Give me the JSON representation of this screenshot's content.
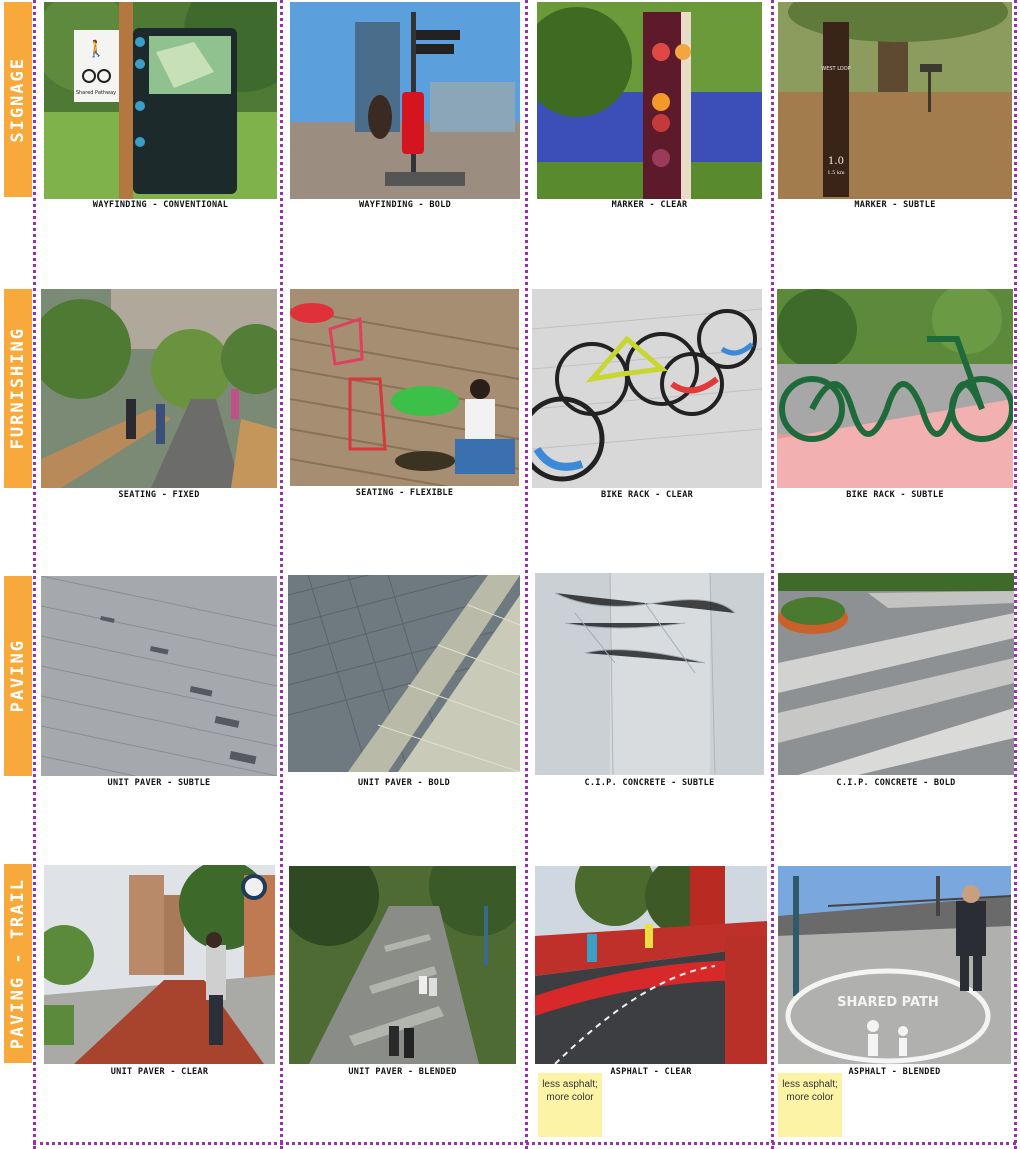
{
  "rows": [
    {
      "label": "SIGNAGE",
      "captions": [
        "WAYFINDING - CONVENTIONAL",
        "WAYFINDING - BOLD",
        "MARKER - CLEAR",
        "MARKER - SUBTLE"
      ]
    },
    {
      "label": "FURNISHING",
      "captions": [
        "SEATING - FIXED",
        "SEATING - FLEXIBLE",
        "BIKE RACK - CLEAR",
        "BIKE RACK - SUBTLE"
      ]
    },
    {
      "label": "PAVING",
      "captions": [
        "UNIT PAVER - SUBTLE",
        "UNIT PAVER - BOLD",
        "C.I.P. CONCRETE - SUBTLE",
        "C.I.P. CONCRETE - BOLD"
      ]
    },
    {
      "label": "PAVING - TRAIL",
      "captions": [
        "UNIT PAVER - CLEAR",
        "UNIT PAVER - BLENDED",
        "ASPHALT - CLEAR",
        "ASPHALT - BLENDED"
      ]
    }
  ],
  "notes": [
    {
      "text": "less asphalt; more color"
    },
    {
      "text": "less asphalt; more color"
    }
  ],
  "photo_text": {
    "sign_label": "Shared Pathway",
    "marker_label": "WEST LOOP",
    "marker_distance": "1.0",
    "marker_distance_km": "1.5 km",
    "shared_path": "SHARED PATH"
  },
  "colors": {
    "label_bg": "#f7a93b",
    "divider": "#9b2fae",
    "note_bg": "#fdf3a6"
  }
}
